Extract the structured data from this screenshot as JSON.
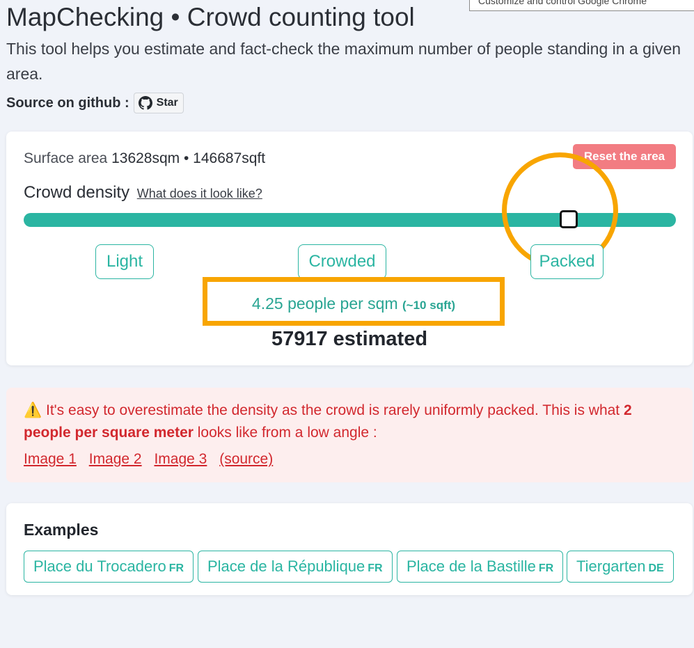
{
  "tooltip": {
    "text": "Customize and control Google Chrome"
  },
  "header": {
    "title": "MapChecking • Crowd counting tool",
    "description": "This tool helps you estimate and fact-check the maximum number of people standing in a given area.",
    "source_label": "Source on github :",
    "star_label": "Star"
  },
  "calculator": {
    "surface_prefix": "Surface area",
    "surface_value": "13628sqm • 146687sqft",
    "reset_label": "Reset the area",
    "density_label": "Crowd density",
    "density_link": "What does it look like?",
    "slider_value": 4.25,
    "presets": [
      "Light",
      "Crowded",
      "Packed"
    ],
    "per_sqm_main": "4.25 people per sqm",
    "per_sqm_sub": "(~10 sqft)",
    "estimated": "57917 estimated"
  },
  "alert": {
    "text_before": "It's easy to overestimate the density as the crowd is rarely uniformly packed. This is what",
    "bold": "2 people per square meter",
    "text_after": "looks like from a low angle :",
    "links": [
      "Image 1",
      "Image 2",
      "Image 3"
    ],
    "source_link": "(source)"
  },
  "examples": {
    "title": "Examples",
    "items": [
      {
        "name": "Place du Trocadero",
        "country": "FR"
      },
      {
        "name": "Place de la République",
        "country": "FR"
      },
      {
        "name": "Place de la Bastille",
        "country": "FR"
      },
      {
        "name": "Tiergarten",
        "country": "DE"
      }
    ]
  },
  "colors": {
    "accent": "#2bb5a2",
    "danger": "#d2282e",
    "reset": "#f27c82",
    "highlight": "#f8a500"
  }
}
